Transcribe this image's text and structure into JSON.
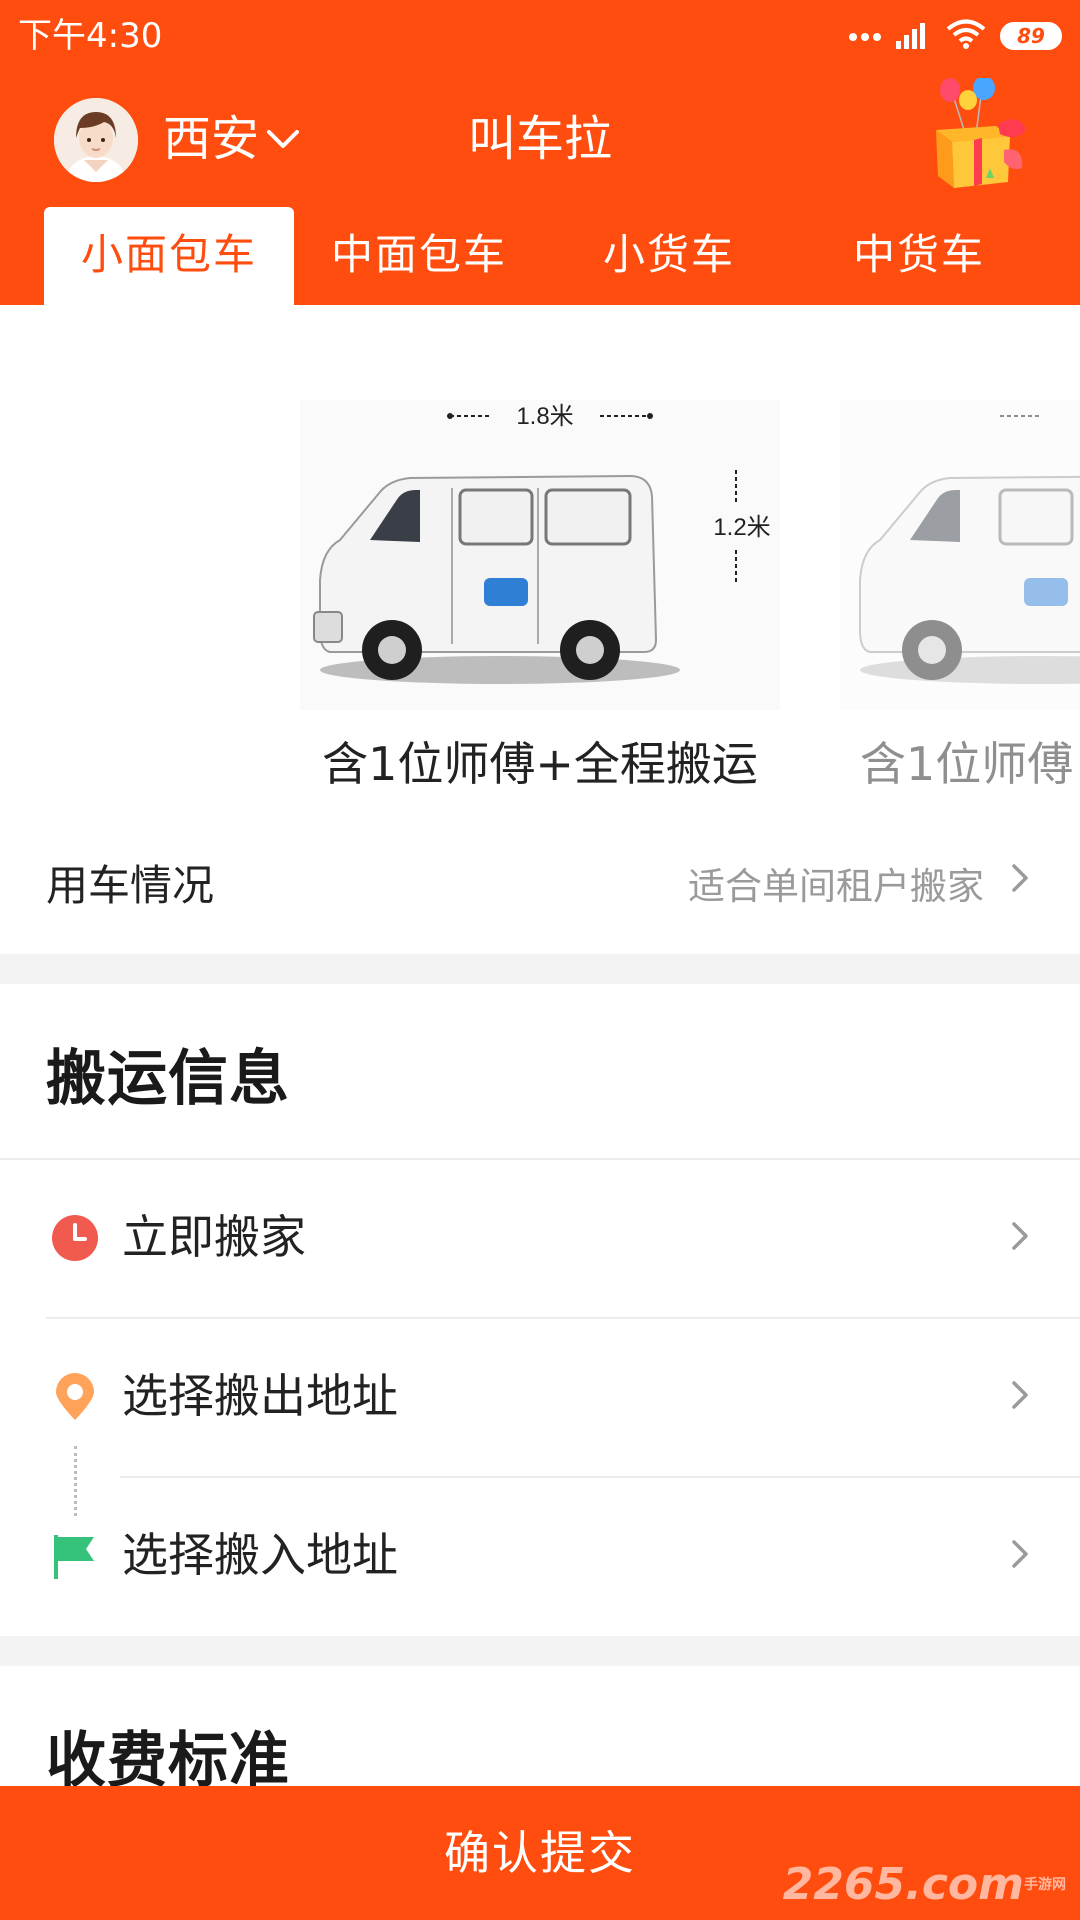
{
  "status_bar": {
    "time": "下午4:30",
    "battery": "89"
  },
  "header": {
    "city": "西安",
    "title": "叫车拉"
  },
  "tabs": [
    {
      "label": "小面包车",
      "active": true
    },
    {
      "label": "中面包车",
      "active": false
    },
    {
      "label": "小货车",
      "active": false
    },
    {
      "label": "中货车",
      "active": false
    }
  ],
  "vehicles": [
    {
      "width_label": "1.8米",
      "height_label": "1.2米",
      "caption": "含1位师傅+全程搬运"
    },
    {
      "caption": "含1位师傅"
    }
  ],
  "usage": {
    "label": "用车情况",
    "value": "适合单间租户搬家"
  },
  "move_info": {
    "title": "搬运信息",
    "rows": [
      {
        "label": "立即搬家",
        "icon": "clock-icon"
      },
      {
        "label": "选择搬出地址",
        "icon": "location-pin-icon"
      },
      {
        "label": "选择搬入地址",
        "icon": "flag-icon"
      }
    ]
  },
  "fees": {
    "title": "收费标准"
  },
  "submit_label": "确认提交",
  "watermark": {
    "number": "2265",
    "suffix": ".com",
    "subtitle": "手游网"
  },
  "colors": {
    "brand": "#ff4d0f",
    "clock": "#f05a4f",
    "pin": "#ffa25a",
    "flag": "#35c27a"
  }
}
